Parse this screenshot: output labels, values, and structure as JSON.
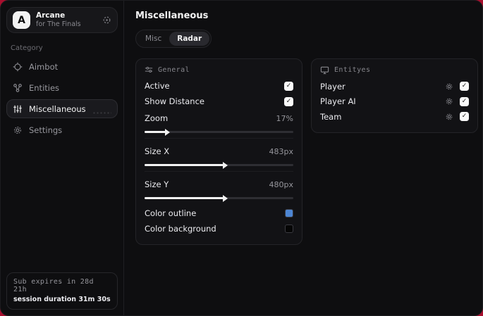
{
  "app": {
    "initial": "A",
    "name": "Arcane",
    "subtitle": "for The Finals"
  },
  "sidebar": {
    "category_label": "Category",
    "items": [
      {
        "label": "Aimbot",
        "icon": "crosshair-icon",
        "active": false
      },
      {
        "label": "Entities",
        "icon": "entities-icon",
        "active": false
      },
      {
        "label": "Miscellaneous",
        "icon": "sliders-icon",
        "active": true
      },
      {
        "label": "Settings",
        "icon": "gear-icon",
        "active": false
      }
    ],
    "status": {
      "line1": "Sub expires in 28d 21h",
      "line2": "session duration 31m 30s"
    }
  },
  "main": {
    "title": "Miscellaneous",
    "tabs": [
      {
        "label": "Misc",
        "active": false
      },
      {
        "label": "Radar",
        "active": true
      }
    ]
  },
  "general_panel": {
    "title": "General",
    "toggles": [
      {
        "label": "Active",
        "checked": true
      },
      {
        "label": "Show Distance",
        "checked": true
      }
    ],
    "sliders": [
      {
        "label": "Zoom",
        "value": "17%",
        "fill_pct": 14
      },
      {
        "label": "Size X",
        "value": "483px",
        "fill_pct": 53
      },
      {
        "label": "Size Y",
        "value": "480px",
        "fill_pct": 53
      }
    ],
    "colors": [
      {
        "label": "Color outline",
        "hex": "#4d86d4"
      },
      {
        "label": "Color background",
        "hex": "#050505"
      }
    ]
  },
  "entities_panel": {
    "title": "Entityes",
    "rows": [
      {
        "label": "Player",
        "checked": true
      },
      {
        "label": "Player AI",
        "checked": true
      },
      {
        "label": "Team",
        "checked": true
      }
    ]
  },
  "glyphs": {
    "check": "✓"
  },
  "colors": {
    "backdrop": "#a80f2e",
    "window_bg": "#0e0e10",
    "panel_bg": "#121215",
    "accent_blue": "#4d86d4"
  }
}
